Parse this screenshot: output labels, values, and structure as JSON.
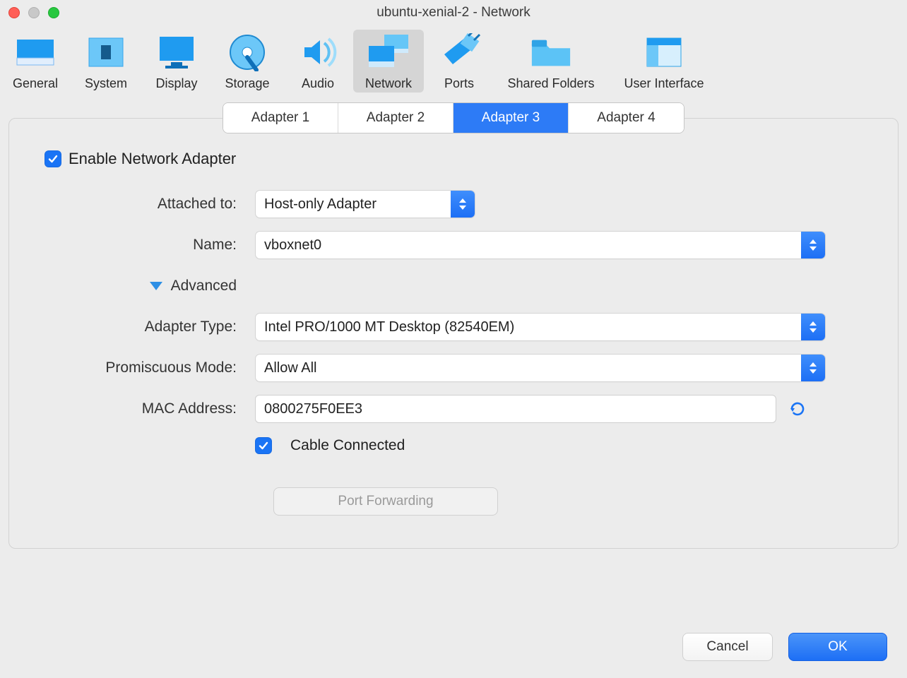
{
  "window": {
    "title": "ubuntu-xenial-2 - Network"
  },
  "toolbar": {
    "items": [
      {
        "label": "General"
      },
      {
        "label": "System"
      },
      {
        "label": "Display"
      },
      {
        "label": "Storage"
      },
      {
        "label": "Audio"
      },
      {
        "label": "Network"
      },
      {
        "label": "Ports"
      },
      {
        "label": "Shared Folders"
      },
      {
        "label": "User Interface"
      }
    ],
    "active_index": 5
  },
  "tabs": {
    "labels": [
      "Adapter 1",
      "Adapter 2",
      "Adapter 3",
      "Adapter 4"
    ],
    "active_index": 2
  },
  "form": {
    "enable_label": "Enable Network Adapter",
    "enable_checked": true,
    "attached_label": "Attached to:",
    "attached_value": "Host-only Adapter",
    "name_label": "Name:",
    "name_value": "vboxnet0",
    "advanced_label": "Advanced",
    "adapter_type_label": "Adapter Type:",
    "adapter_type_value": "Intel PRO/1000 MT Desktop (82540EM)",
    "promiscuous_label": "Promiscuous Mode:",
    "promiscuous_value": "Allow All",
    "mac_label": "MAC Address:",
    "mac_value": "0800275F0EE3",
    "cable_label": "Cable Connected",
    "cable_checked": true,
    "port_forwarding_label": "Port Forwarding"
  },
  "buttons": {
    "cancel": "Cancel",
    "ok": "OK"
  }
}
